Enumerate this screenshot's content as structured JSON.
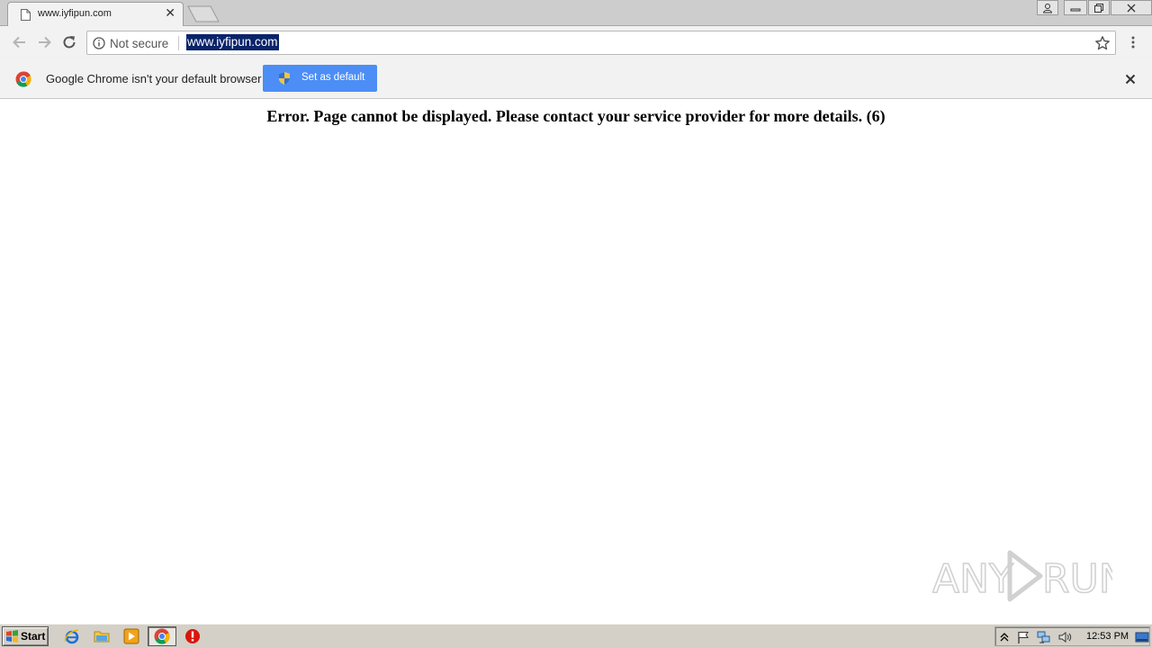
{
  "tab": {
    "title": "www.iyfipun.com"
  },
  "omnibox": {
    "security_label": "Not secure",
    "url": "www.iyfipun.com"
  },
  "infobar": {
    "message": "Google Chrome isn't your default browser",
    "button_label": "Set as default"
  },
  "content": {
    "error_message": "Error. Page cannot be displayed. Please contact your service provider for more details. (6)"
  },
  "watermark": {
    "text": "ANY RUN"
  },
  "taskbar": {
    "start_label": "Start",
    "clock": "12:53 PM"
  },
  "colors": {
    "accent_button": "#4c8ef5",
    "url_selection": "#0a246a",
    "taskbar": "#d4d0c8"
  },
  "icons": [
    "page-icon",
    "close-icon",
    "new-tab-icon",
    "user-icon",
    "minimize-icon",
    "restore-icon",
    "back-arrow-icon",
    "forward-arrow-icon",
    "reload-icon",
    "info-icon",
    "star-icon",
    "menu-icon",
    "chrome-logo-icon",
    "shield-icon",
    "windows-logo-icon",
    "ie-icon",
    "folder-icon",
    "media-player-icon",
    "chrome-icon",
    "stop-icon",
    "arrow-up-icon",
    "flag-icon",
    "network-icon",
    "volume-icon",
    "desktop-icon"
  ]
}
